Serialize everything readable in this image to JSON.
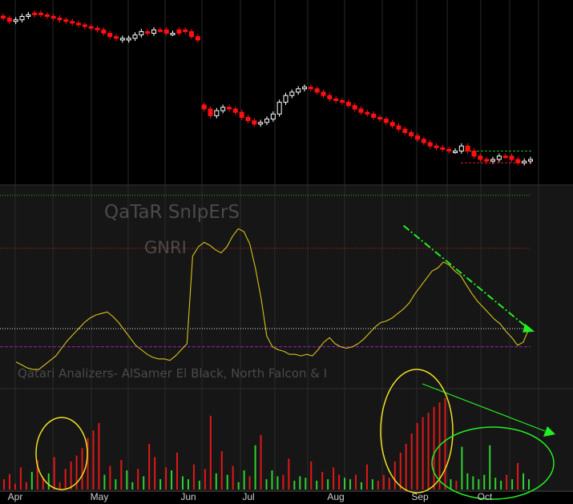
{
  "watermarks": {
    "title": "QaTaR SnIpErS",
    "indicator": "GNRI",
    "credit": "Qatari Analizers- AlSamer El Black, North Falcon & I"
  },
  "colors": {
    "background": "#000000",
    "panel_background": "#161616",
    "grid": "#2a2a2a",
    "up_candle": "#ffffff",
    "down_candle": "#ff1010",
    "indicator_line": "#d8c21c",
    "volume_up": "#30d030",
    "volume_down": "#e01818",
    "level_green": "#16c016",
    "level_red": "#d82020",
    "level_white": "#e8e8e8",
    "level_purple": "#a020c0",
    "annotation_yellow": "#f0e020",
    "annotation_green": "#22ee22"
  },
  "chart_data": [
    {
      "type": "candlestick",
      "x_labels": [
        "Apr",
        "May",
        "Jun",
        "Jul",
        "Aug",
        "Sep",
        "Oct"
      ],
      "close": [
        97,
        96,
        96.5,
        97.5,
        98,
        98.5,
        98,
        97.5,
        97,
        96.5,
        96,
        95.5,
        95,
        94.5,
        94,
        93.5,
        92.5,
        91.5,
        91,
        90.5,
        91,
        92,
        93,
        92.5,
        93.5,
        93.5,
        92.5,
        92.5,
        93.5,
        93,
        91.5,
        90.5,
        70,
        68,
        69.5,
        70.5,
        70,
        69,
        67.5,
        66.5,
        65.5,
        66,
        67,
        68.5,
        72,
        74,
        75,
        76,
        76.5,
        76,
        75,
        74,
        73,
        72.5,
        72,
        71,
        70,
        69,
        68.5,
        67.5,
        67,
        66,
        65,
        64,
        63,
        62,
        61,
        60,
        59,
        58.5,
        58,
        57.5,
        57.5,
        59,
        57.5,
        56,
        55,
        54.5,
        55,
        56,
        56,
        55,
        54,
        54.5,
        55
      ],
      "up": [
        false,
        false,
        true,
        true,
        true,
        false,
        false,
        false,
        false,
        false,
        false,
        false,
        false,
        false,
        false,
        false,
        false,
        false,
        false,
        true,
        true,
        true,
        true,
        false,
        true,
        false,
        false,
        true,
        false,
        false,
        false,
        false,
        false,
        false,
        true,
        true,
        false,
        false,
        false,
        false,
        false,
        true,
        true,
        true,
        true,
        true,
        true,
        true,
        true,
        false,
        false,
        false,
        false,
        false,
        false,
        false,
        false,
        false,
        false,
        false,
        false,
        false,
        false,
        false,
        false,
        false,
        false,
        false,
        false,
        false,
        false,
        false,
        true,
        true,
        false,
        false,
        false,
        false,
        true,
        true,
        false,
        false,
        false,
        true,
        true
      ],
      "levels": [
        {
          "value": 57.5,
          "style": "dashed",
          "color": "green"
        },
        {
          "value": 54,
          "style": "dashed",
          "color": "red"
        }
      ]
    },
    {
      "type": "line",
      "name": "GNRI",
      "values": [
        10,
        8,
        6,
        5,
        5,
        8,
        11,
        14,
        19,
        24,
        28,
        32,
        36,
        39,
        41,
        42,
        43,
        40,
        36,
        31,
        26,
        21,
        18,
        15,
        13,
        12,
        12,
        11,
        14,
        18,
        22,
        80,
        86,
        89,
        87,
        84,
        82,
        86,
        93,
        98,
        96,
        88,
        72,
        52,
        27,
        20,
        18,
        17,
        15,
        15,
        14,
        15,
        14,
        18,
        23,
        26,
        22,
        20,
        19,
        20,
        22,
        25,
        29,
        33,
        36,
        37,
        39,
        42,
        45,
        49,
        55,
        60,
        65,
        70,
        72,
        76,
        74,
        70,
        67,
        61,
        55,
        50,
        46,
        42,
        38,
        35,
        30,
        26,
        21,
        23,
        32
      ],
      "levels": [
        {
          "value": 120,
          "color": "green",
          "style": "dotted"
        },
        {
          "value": 85,
          "color": "red",
          "style": "dotted"
        },
        {
          "value": 32,
          "color": "white",
          "style": "dotted"
        },
        {
          "value": 20,
          "color": "purple",
          "style": "dashed"
        }
      ],
      "trend_line": {
        "from": [
          68,
          100
        ],
        "to": [
          91,
          30
        ],
        "color": "green",
        "style": "dash-dot",
        "arrow": true
      }
    },
    {
      "type": "bar",
      "name": "volume",
      "values": [
        14,
        21,
        8,
        30,
        10,
        24,
        40,
        16,
        22,
        44,
        10,
        28,
        38,
        46,
        56,
        70,
        80,
        90,
        20,
        32,
        14,
        40,
        26,
        10,
        28,
        18,
        62,
        44,
        14,
        30,
        26,
        50,
        18,
        14,
        34,
        12,
        28,
        100,
        22,
        52,
        20,
        32,
        10,
        26,
        18,
        60,
        74,
        14,
        26,
        18,
        20,
        42,
        12,
        18,
        16,
        38,
        12,
        24,
        14,
        30,
        20,
        16,
        14,
        20,
        10,
        34,
        14,
        12,
        20,
        16,
        38,
        50,
        62,
        76,
        90,
        98,
        104,
        112,
        118,
        124,
        14,
        12,
        58,
        22,
        18,
        14,
        20,
        60,
        16,
        12,
        20,
        14,
        36,
        22,
        14
      ],
      "up": [
        false,
        false,
        false,
        false,
        false,
        true,
        false,
        false,
        true,
        false,
        false,
        false,
        false,
        false,
        false,
        false,
        false,
        false,
        true,
        false,
        true,
        false,
        true,
        true,
        false,
        true,
        false,
        false,
        true,
        false,
        true,
        false,
        true,
        true,
        false,
        true,
        false,
        false,
        true,
        false,
        true,
        false,
        true,
        true,
        false,
        true,
        false,
        true,
        true,
        true,
        false,
        false,
        true,
        true,
        true,
        false,
        true,
        false,
        true,
        false,
        false,
        true,
        true,
        false,
        true,
        false,
        true,
        false,
        false,
        false,
        false,
        false,
        false,
        false,
        false,
        false,
        false,
        false,
        false,
        false,
        true,
        false,
        true,
        true,
        true,
        true,
        true,
        true,
        true,
        true,
        false,
        true,
        false,
        true,
        true
      ]
    }
  ]
}
